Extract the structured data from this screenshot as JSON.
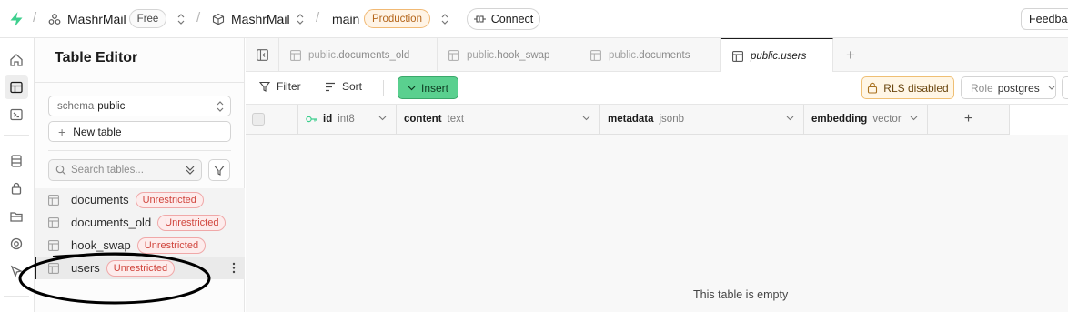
{
  "topbar": {
    "org_name": "MashrMail",
    "org_plan": "Free",
    "project_name": "MashrMail",
    "branch_name": "main",
    "branch_env": "Production",
    "connect_label": "Connect",
    "feedback_label": "Feedbac"
  },
  "sidebar": {
    "title": "Table Editor",
    "schema_label": "schema",
    "schema_value": "public",
    "new_table_label": "New table",
    "search_placeholder": "Search tables...",
    "tables": [
      {
        "name": "documents",
        "badge": "Unrestricted"
      },
      {
        "name": "documents_old",
        "badge": "Unrestricted"
      },
      {
        "name": "hook_swap",
        "badge": "Unrestricted"
      },
      {
        "name": "users",
        "badge": "Unrestricted"
      }
    ]
  },
  "tabs": [
    {
      "schema": "public.",
      "table": "documents_old"
    },
    {
      "schema": "public.",
      "table": "hook_swap"
    },
    {
      "schema": "public.",
      "table": "documents"
    },
    {
      "schema": "public.",
      "table": "users"
    }
  ],
  "toolbar": {
    "filter_label": "Filter",
    "sort_label": "Sort",
    "insert_label": "Insert",
    "rls_label": "RLS disabled",
    "role_label": "Role",
    "role_value": "postgres"
  },
  "grid": {
    "columns": [
      {
        "name": "id",
        "type": "int8"
      },
      {
        "name": "content",
        "type": "text"
      },
      {
        "name": "metadata",
        "type": "jsonb"
      },
      {
        "name": "embedding",
        "type": "vector"
      }
    ],
    "empty_message": "This table is empty"
  },
  "colors": {
    "brand_green": "#3ecf8e",
    "insert_green": "#5ad08f",
    "badge_red": "#d0453d",
    "production_orange": "#b4651a"
  }
}
